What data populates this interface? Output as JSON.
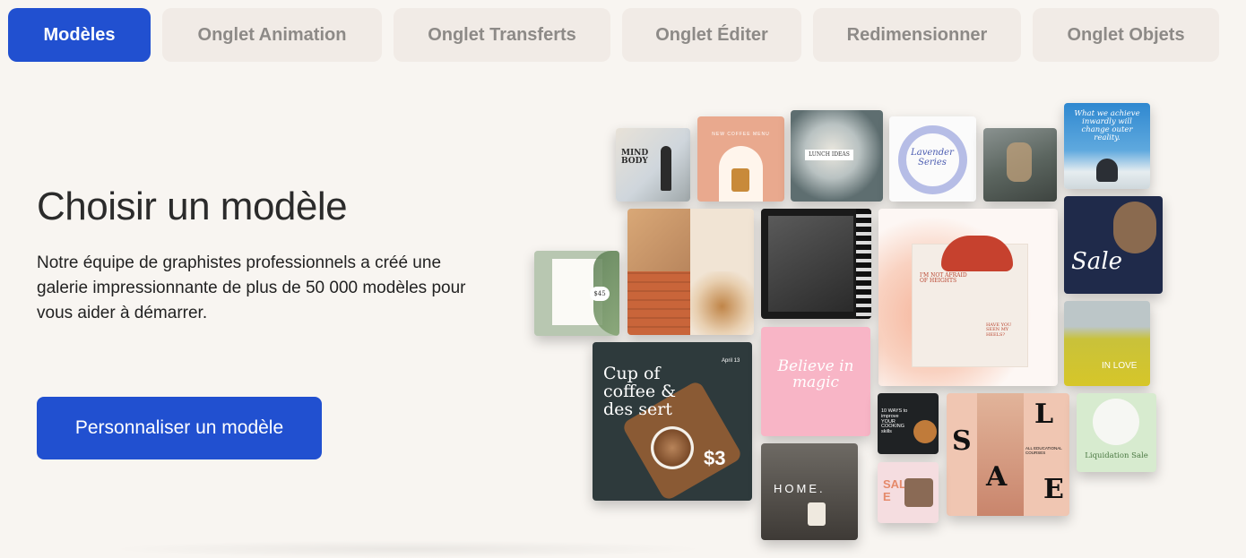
{
  "tabs": [
    {
      "label": "Modèles",
      "active": true
    },
    {
      "label": "Onglet Animation",
      "active": false
    },
    {
      "label": "Onglet Transferts",
      "active": false
    },
    {
      "label": "Onglet Éditer",
      "active": false
    },
    {
      "label": "Redimensionner",
      "active": false
    },
    {
      "label": "Onglet Objets",
      "active": false
    }
  ],
  "hero": {
    "title": "Choisir un modèle",
    "description": "Notre équipe de graphistes professionnels a créé une galerie impressionnante de plus de 50 000 modèles pour vous aider à démarrer.",
    "cta_label": "Personnaliser un modèle"
  },
  "templates": {
    "mind_body": "MIND BODY",
    "new_coffee_menu": "NEW COFFEE MENU",
    "lunch_ideas": "LUNCH IDEAS",
    "lavender_series": "Lavender Series",
    "reality_quote": "What we achieve inwardly will change outer reality.",
    "price_45": "$45",
    "afraid_heights": "I'M NOT AFRAID OF HEIGHTS",
    "seen_heels": "HAVE YOU SEEN MY HEELS?",
    "sale_script": "Sale",
    "in_love": "IN LOVE",
    "cup_of_coffee": "Cup of coffee & des sert",
    "coffee_date": "April 13",
    "price_3": "$3",
    "believe_magic": "Believe in magic",
    "ways_cooking": "10 WAYS to improve YOUR COOKING skills",
    "sale_s": "S",
    "sale_l": "L",
    "sale_a": "A",
    "sale_e": "E",
    "sale_small": "SALE",
    "educational_courses": "ALL EDUCATIONAL COURSES",
    "liquidation_sale": "Liquidation Sale",
    "home": "HOME."
  },
  "colors": {
    "accent": "#2150d0",
    "tab_bg": "#f1ebe6",
    "tab_text": "#8d8a87",
    "page_bg": "#f8f5f1"
  }
}
